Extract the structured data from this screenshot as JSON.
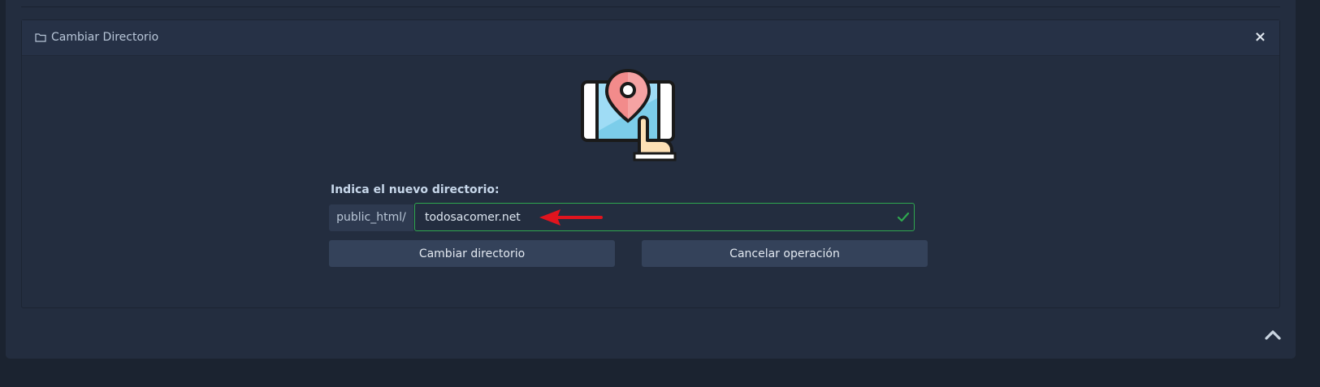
{
  "card": {
    "title": "Cambiar Directorio",
    "close_label": "×"
  },
  "form": {
    "label": "Indica el nuevo directorio:",
    "prefix": "public_html/",
    "input_value": "todosacomer.net"
  },
  "buttons": {
    "change_label": "Cambiar directorio",
    "cancel_label": "Cancelar operación"
  },
  "icons": {
    "folder": "folder-outline-icon",
    "close": "close-icon",
    "illustration": "map-pin-touch-icon",
    "check": "check-icon",
    "arrow": "red-arrow-pointer",
    "scroll_top": "chevron-up-icon"
  },
  "colors": {
    "valid_border": "#2fa84f",
    "arrow": "#e0141e"
  }
}
